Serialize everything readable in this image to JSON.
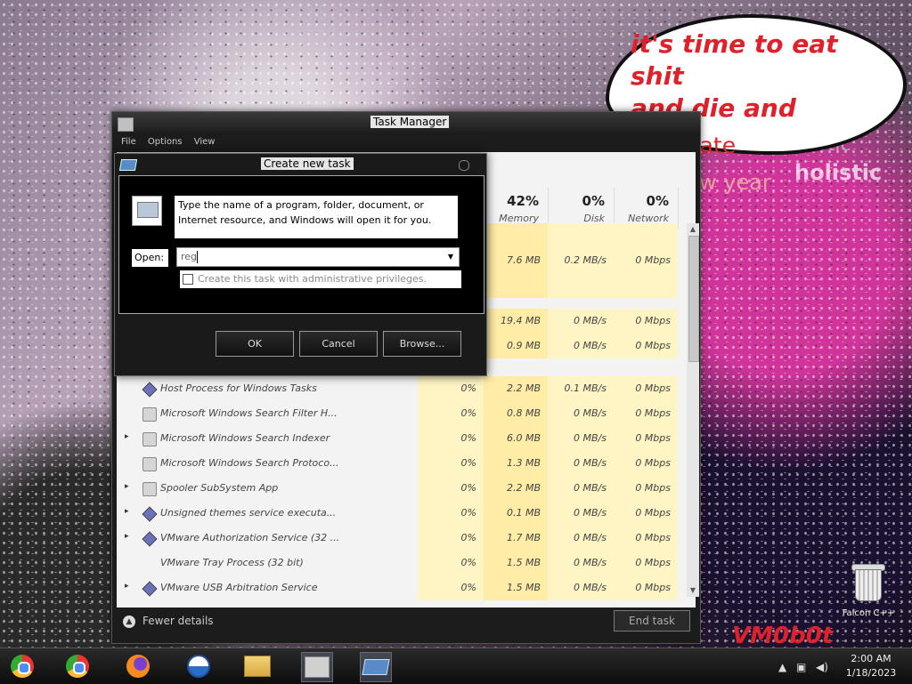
{
  "desktop": {
    "bubble": {
      "line1": "it's time to eat shit",
      "line2a": "and die and",
      "line2b": "celebrate",
      "line3": "the new year"
    },
    "sign_text_top": "artistic",
    "sign_text": "holistic",
    "watermark": "VM0b0t",
    "recycle_bin_label": "Falcon C++"
  },
  "task_manager": {
    "title": "Task Manager",
    "menu": [
      "File",
      "Options",
      "View"
    ],
    "columns": {
      "memory": {
        "pct": "42%",
        "label": "Memory"
      },
      "disk": {
        "pct": "0%",
        "label": "Disk"
      },
      "network": {
        "pct": "0%",
        "label": "Network"
      }
    },
    "partial_rows": [
      {
        "mem": "7.6 MB",
        "disk": "0.2 MB/s",
        "net": "0 Mbps"
      },
      {
        "mem": "19.4 MB",
        "disk": "0 MB/s",
        "net": "0 Mbps"
      },
      {
        "mem": "0.9 MB",
        "disk": "0 MB/s",
        "net": "0 Mbps"
      }
    ],
    "rows": [
      {
        "expand": "",
        "icon": "service-icon",
        "name": "Host Process for Windows Tasks",
        "cpu": "0%",
        "mem": "2.2 MB",
        "disk": "0.1 MB/s",
        "net": "0 Mbps"
      },
      {
        "expand": "",
        "icon": "search-service-icon",
        "name": "Microsoft Windows Search Filter H...",
        "cpu": "0%",
        "mem": "0.8 MB",
        "disk": "0 MB/s",
        "net": "0 Mbps"
      },
      {
        "expand": "▸",
        "icon": "search-service-icon",
        "name": "Microsoft Windows Search Indexer",
        "cpu": "0%",
        "mem": "6.0 MB",
        "disk": "0 MB/s",
        "net": "0 Mbps"
      },
      {
        "expand": "",
        "icon": "search-service-icon",
        "name": "Microsoft Windows Search Protoco...",
        "cpu": "0%",
        "mem": "1.3 MB",
        "disk": "0 MB/s",
        "net": "0 Mbps"
      },
      {
        "expand": "▸",
        "icon": "printer-icon",
        "name": "Spooler SubSystem App",
        "cpu": "0%",
        "mem": "2.2 MB",
        "disk": "0 MB/s",
        "net": "0 Mbps"
      },
      {
        "expand": "▸",
        "icon": "service-icon",
        "name": "Unsigned themes service executa...",
        "cpu": "0%",
        "mem": "0.1 MB",
        "disk": "0 MB/s",
        "net": "0 Mbps"
      },
      {
        "expand": "▸",
        "icon": "service-icon",
        "name": "VMware Authorization Service (32 ...",
        "cpu": "0%",
        "mem": "1.7 MB",
        "disk": "0 MB/s",
        "net": "0 Mbps"
      },
      {
        "expand": "",
        "icon": "blank-icon",
        "name": "VMware Tray Process (32 bit)",
        "cpu": "0%",
        "mem": "1.5 MB",
        "disk": "0 MB/s",
        "net": "0 Mbps"
      },
      {
        "expand": "▸",
        "icon": "service-icon",
        "name": "VMware USB Arbitration Service",
        "cpu": "0%",
        "mem": "1.5 MB",
        "disk": "0 MB/s",
        "net": "0 Mbps"
      }
    ],
    "fewer_details": "Fewer details",
    "end_task": "End task"
  },
  "run_dialog": {
    "title": "Create new task",
    "description": "Type the name of a program, folder, document, or Internet resource, and Windows will open it for you.",
    "open_label": "Open:",
    "input_value": "reg",
    "admin_checkbox_label": "Create this task with administrative privileges.",
    "ok": "OK",
    "cancel": "Cancel",
    "browse": "Browse..."
  },
  "taskbar": {
    "time": "2:00 AM",
    "date": "1/18/2023"
  }
}
